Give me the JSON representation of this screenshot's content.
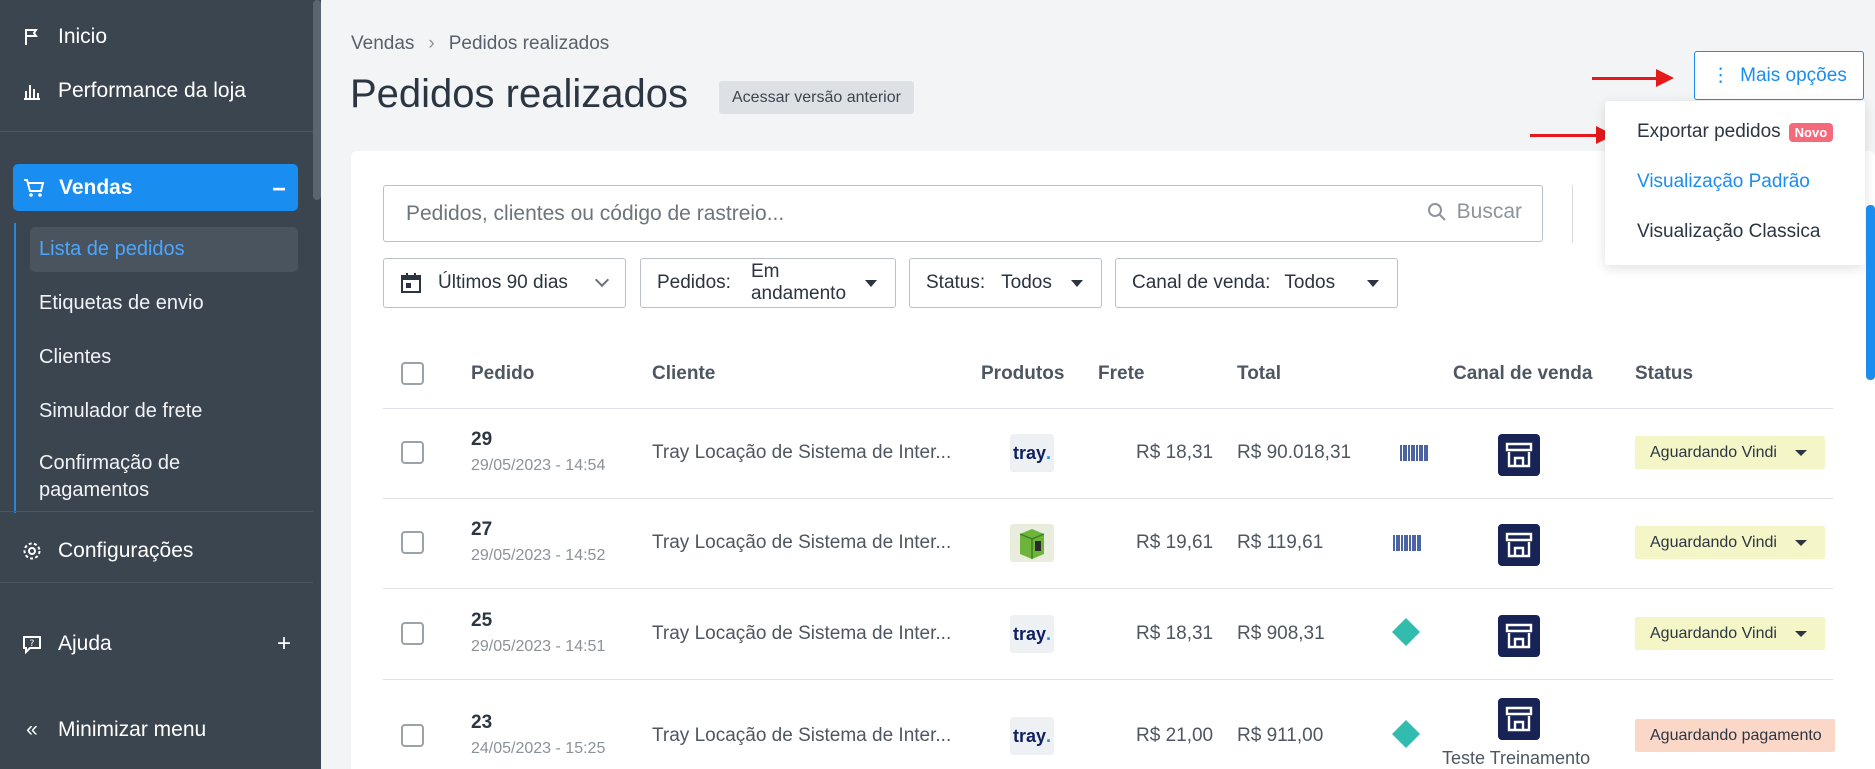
{
  "sidebar": {
    "inicio": "Inicio",
    "performance": "Performance da loja",
    "vendas": "Vendas",
    "sub": [
      "Lista de pedidos",
      "Etiquetas de envio",
      "Clientes",
      "Simulador de frete",
      "Confirmação de pagamentos"
    ],
    "configuracoes": "Configurações",
    "ajuda": "Ajuda",
    "minimizar": "Minimizar menu",
    "accent": "#1a8df1"
  },
  "header": {
    "breadcrumb": [
      "Vendas",
      "Pedidos realizados"
    ],
    "title": "Pedidos realizados",
    "old_version": "Acessar versão anterior",
    "more_options": "Mais opções"
  },
  "dropdown": {
    "export": "Exportar pedidos",
    "badge": "Novo",
    "view_default": "Visualização Padrão",
    "view_classic": "Visualização Classica"
  },
  "search": {
    "placeholder": "Pedidos, clientes ou código de rastreio...",
    "button": "Buscar"
  },
  "filters": {
    "period": "Últimos 90 dias",
    "orders_label": "Pedidos:",
    "orders_value": "Em andamento",
    "status_label": "Status:",
    "status_value": "Todos",
    "channel_label": "Canal de venda:",
    "channel_value": "Todos"
  },
  "table": {
    "headers": [
      "Pedido",
      "Cliente",
      "Produtos",
      "Frete",
      "Total",
      "Canal de venda",
      "Status"
    ],
    "rows": [
      {
        "id": "29",
        "date": "29/05/2023 - 14:54",
        "client": "Tray Locação de Sistema de Inter...",
        "product": "tray",
        "freight": "R$ 18,31",
        "total": "R$ 90.018,31",
        "payment_icon": "barcode-icon",
        "channel": "",
        "status": "Aguardando Vindi"
      },
      {
        "id": "27",
        "date": "29/05/2023 - 14:52",
        "client": "Tray Locação de Sistema de Inter...",
        "product": "green-box",
        "freight": "R$ 19,61",
        "total": "R$ 119,61",
        "payment_icon": "barcode-icon",
        "channel": "",
        "status": "Aguardando Vindi"
      },
      {
        "id": "25",
        "date": "29/05/2023 - 14:51",
        "client": "Tray Locação de Sistema de Inter...",
        "product": "tray",
        "freight": "R$ 18,31",
        "total": "R$ 908,31",
        "payment_icon": "pix-icon",
        "channel": "",
        "status": "Aguardando Vindi"
      },
      {
        "id": "23",
        "date": "24/05/2023 - 15:25",
        "client": "Tray Locação de Sistema de Inter...",
        "product": "tray",
        "freight": "R$ 21,00",
        "total": "R$ 911,00",
        "payment_icon": "pix-icon",
        "channel": "Teste Treinamento",
        "status": "Aguardando pagamento"
      }
    ]
  }
}
